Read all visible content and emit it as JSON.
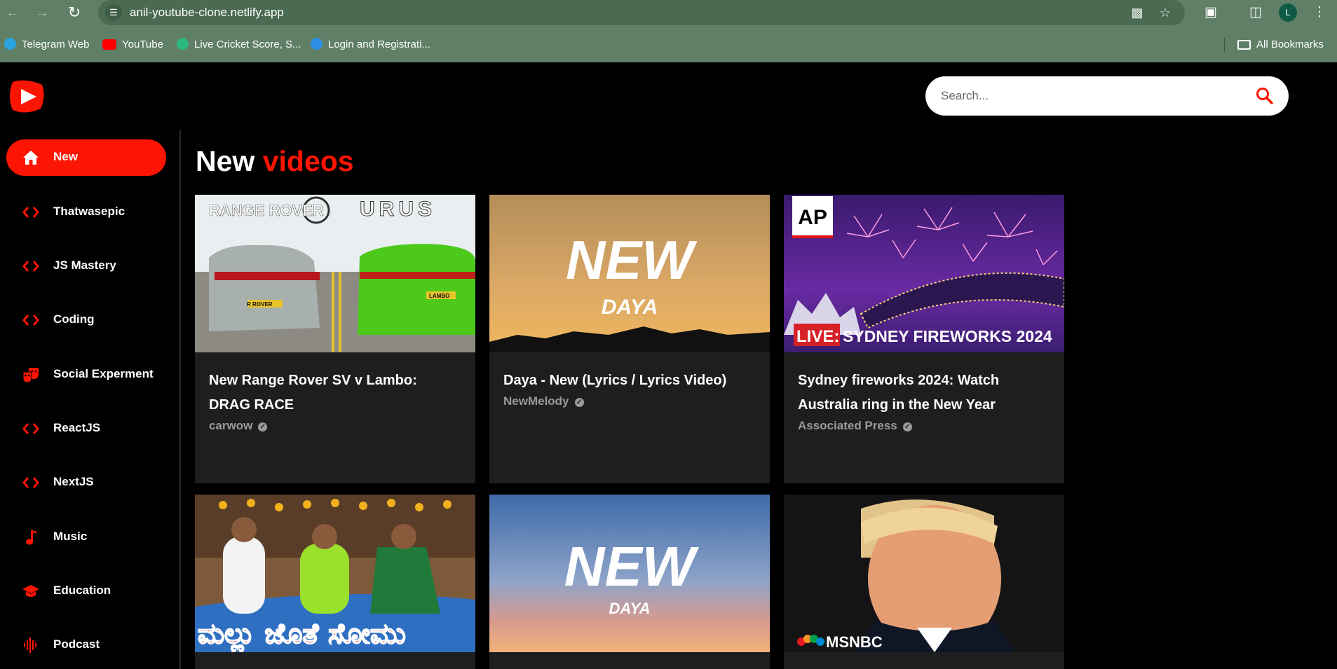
{
  "browser": {
    "url": "anil-youtube-clone.netlify.app",
    "profile_initial": "L",
    "bookmarks": [
      {
        "label": "Telegram Web",
        "color": "#2aa3e0"
      },
      {
        "label": "YouTube",
        "color": "#ff0000"
      },
      {
        "label": "Live Cricket Score, S...",
        "color": "#2db87f"
      },
      {
        "label": "Login and Registrati...",
        "color": "#2d8fe6"
      }
    ],
    "all_bookmarks": "All Bookmarks"
  },
  "app": {
    "search_placeholder": "Search...",
    "accent_color": "#fc1503",
    "sidebar": [
      {
        "label": "New",
        "icon": "home-icon",
        "active": true
      },
      {
        "label": "Thatwasepic",
        "icon": "code-icon"
      },
      {
        "label": "JS Mastery",
        "icon": "code-icon"
      },
      {
        "label": "Coding",
        "icon": "code-icon"
      },
      {
        "label": "Social Experment",
        "icon": "theater-masks-icon"
      },
      {
        "label": "ReactJS",
        "icon": "code-icon"
      },
      {
        "label": "NextJS",
        "icon": "code-icon"
      },
      {
        "label": "Music",
        "icon": "music-note-icon"
      },
      {
        "label": "Education",
        "icon": "graduation-cap-icon"
      },
      {
        "label": "Podcast",
        "icon": "podcast-icon"
      }
    ],
    "feed_title": {
      "white": "New",
      "red": "videos"
    },
    "videos": [
      {
        "title": "New Range Rover SV v Lambo: DRAG RACE",
        "channel": "carwow",
        "thumb_brand_left": "RANGE ROVER",
        "thumb_brand_right": "URUS",
        "plate_left": "R ROVER",
        "plate_right": "LAMBO"
      },
      {
        "title": "Daya - New (Lyrics / Lyrics Video)",
        "channel": "NewMelody",
        "thumb_big": "NEW",
        "thumb_small": "DAYA"
      },
      {
        "title": "Sydney fireworks 2024: Watch Australia ring in the New Year",
        "channel": "Associated Press",
        "thumb_badge": "AP",
        "thumb_live": "LIVE:",
        "thumb_caption": "SYDNEY FIREWORKS 2024"
      },
      {
        "thumb_text": "ಮಲ್ಲು ಜೊತೆ ಸೋಮು"
      },
      {
        "thumb_big": "NEW",
        "thumb_small": "DAYA"
      },
      {
        "thumb_logo": "MSNBC"
      }
    ]
  }
}
